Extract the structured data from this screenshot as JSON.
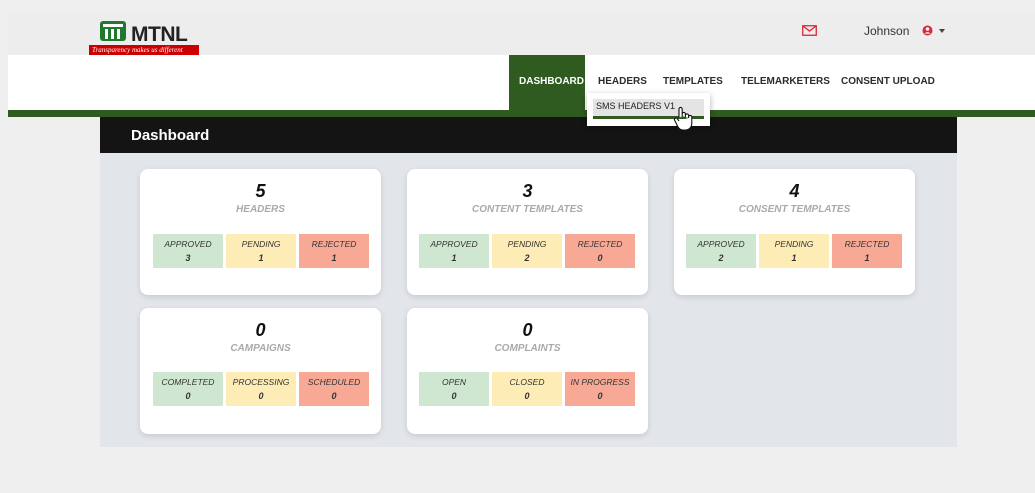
{
  "brand": {
    "name": "MTNL",
    "tagline": "Transparency makes us different"
  },
  "user": {
    "name": "Johnson"
  },
  "nav": {
    "dashboard": "DASHBOARD",
    "headers": "HEADERS",
    "templates": "TEMPLATES",
    "telemarketers": "TELEMARKETERS",
    "consent_upload": "CONSENT UPLOAD"
  },
  "dropdown": {
    "sms_headers": "SMS HEADERS V1"
  },
  "page": {
    "title": "Dashboard"
  },
  "cards": {
    "headers": {
      "count": "5",
      "title": "HEADERS",
      "s1": {
        "label": "APPROVED",
        "value": "3"
      },
      "s2": {
        "label": "PENDING",
        "value": "1"
      },
      "s3": {
        "label": "REJECTED",
        "value": "1"
      }
    },
    "content": {
      "count": "3",
      "title": "CONTENT TEMPLATES",
      "s1": {
        "label": "APPROVED",
        "value": "1"
      },
      "s2": {
        "label": "PENDING",
        "value": "2"
      },
      "s3": {
        "label": "REJECTED",
        "value": "0"
      }
    },
    "consent": {
      "count": "4",
      "title": "CONSENT TEMPLATES",
      "s1": {
        "label": "APPROVED",
        "value": "2"
      },
      "s2": {
        "label": "PENDING",
        "value": "1"
      },
      "s3": {
        "label": "REJECTED",
        "value": "1"
      }
    },
    "campaigns": {
      "count": "0",
      "title": "CAMPAIGNS",
      "s1": {
        "label": "COMPLETED",
        "value": "0"
      },
      "s2": {
        "label": "PROCESSING",
        "value": "0"
      },
      "s3": {
        "label": "SCHEDULED",
        "value": "0"
      }
    },
    "complaints": {
      "count": "0",
      "title": "COMPLAINTS",
      "s1": {
        "label": "OPEN",
        "value": "0"
      },
      "s2": {
        "label": "CLOSED",
        "value": "0"
      },
      "s3": {
        "label": "IN PROGRESS",
        "value": "0"
      }
    }
  },
  "colors": {
    "brand_green": "#2f5a20",
    "approved": "#cfe7d0",
    "pending": "#fdecb5",
    "rejected": "#f8a995"
  },
  "icons": {
    "mail": "mail-icon",
    "user": "user-icon",
    "logo": "mtnl-logo-icon",
    "cursor": "hand-pointer-icon"
  }
}
